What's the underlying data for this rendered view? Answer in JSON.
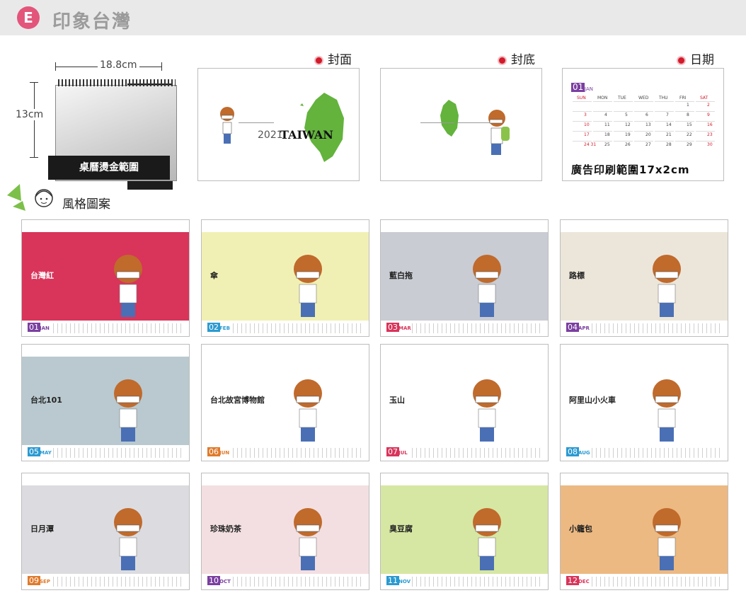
{
  "header": {
    "badge": "E",
    "title": "印象台灣"
  },
  "desk": {
    "width_label": "18.8cm",
    "height_label": "13cm",
    "area_label": "桌曆燙金範圍"
  },
  "style_section": {
    "label": "風格圖案"
  },
  "previews": [
    {
      "label": "封面",
      "cover_year": "2021",
      "cover_word": "TAIWAN"
    },
    {
      "label": "封底"
    },
    {
      "label": "日期",
      "month_num": "01",
      "month_name": "JAN",
      "ad_range": "廣告印刷範圍17x2cm",
      "weekdays": [
        "SUN",
        "MON",
        "TUE",
        "WED",
        "THU",
        "FRI",
        "SAT"
      ],
      "days": [
        "",
        "",
        "",
        "",
        "",
        "1",
        "2",
        "3",
        "4",
        "5",
        "6",
        "7",
        "8",
        "9",
        "10",
        "11",
        "12",
        "13",
        "14",
        "15",
        "16",
        "17",
        "18",
        "19",
        "20",
        "21",
        "22",
        "23",
        "24 31",
        "25",
        "26",
        "27",
        "28",
        "29",
        "30"
      ]
    }
  ],
  "months": [
    {
      "num": "01",
      "name": "JAN",
      "caption": "台灣紅",
      "color": "#d9345a",
      "num_color": "#7b3fa0"
    },
    {
      "num": "02",
      "name": "FEB",
      "caption": "傘",
      "color": "#f1f0b4",
      "num_color": "#2b9ad1"
    },
    {
      "num": "03",
      "name": "MAR",
      "caption": "藍白拖",
      "color": "#c9ccd3",
      "num_color": "#d9345a"
    },
    {
      "num": "04",
      "name": "APR",
      "caption": "路標",
      "color": "#ece6da",
      "num_color": "#7b3fa0"
    },
    {
      "num": "05",
      "name": "MAY",
      "caption": "台北101",
      "color": "#b9c9cf",
      "num_color": "#2b9ad1"
    },
    {
      "num": "06",
      "name": "JUN",
      "caption": "台北故宮博物館",
      "color": "#ffffff",
      "num_color": "#e07a2b"
    },
    {
      "num": "07",
      "name": "JUL",
      "caption": "玉山",
      "color": "#ffffff",
      "num_color": "#d9345a"
    },
    {
      "num": "08",
      "name": "AUG",
      "caption": "阿里山小火車",
      "color": "#ffffff",
      "num_color": "#2b9ad1"
    },
    {
      "num": "09",
      "name": "SEP",
      "caption": "日月潭",
      "color": "#dcdce0",
      "num_color": "#e07a2b"
    },
    {
      "num": "10",
      "name": "OCT",
      "caption": "珍珠奶茶",
      "color": "#f3dfe1",
      "num_color": "#7b3fa0"
    },
    {
      "num": "11",
      "name": "NOV",
      "caption": "臭豆腐",
      "color": "#d6e7a3",
      "num_color": "#2b9ad1"
    },
    {
      "num": "12",
      "name": "DEC",
      "caption": "小籠包",
      "color": "#ecb982",
      "num_color": "#d9345a"
    }
  ],
  "colors": {
    "accent": "#e3557a",
    "dot": "#d11a2a",
    "green_map": "#63b33d"
  }
}
